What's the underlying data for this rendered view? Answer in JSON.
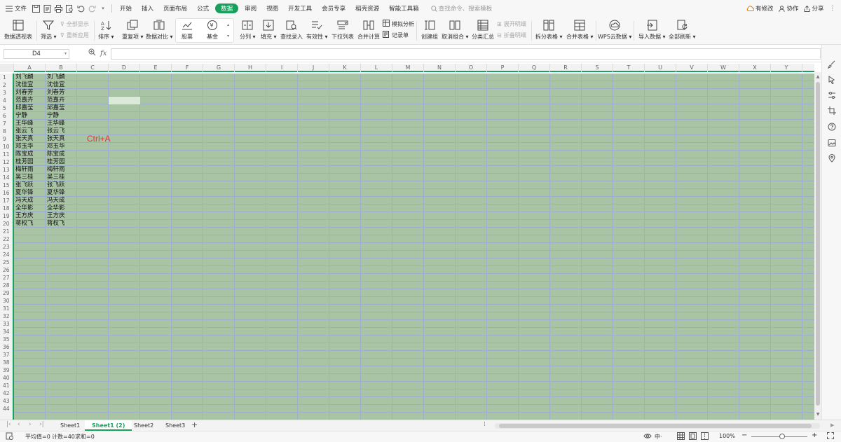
{
  "menubar": {
    "file_label": "文件",
    "tabs": [
      "开始",
      "插入",
      "页面布局",
      "公式",
      "数据",
      "审阅",
      "视图",
      "开发工具",
      "会员专享",
      "稻壳资源",
      "智能工具箱"
    ],
    "active_tab": "数据",
    "search_placeholder": "查找命令、搜索模板",
    "right": {
      "changes": "有修改",
      "collab": "协作",
      "share": "分享"
    }
  },
  "ribbon": {
    "pivot": "数据透视表",
    "filter": "筛选",
    "show_all": "全部显示",
    "reapply": "重新应用",
    "sort": "排序",
    "duplicates": "重复项",
    "compare": "数据对比",
    "stock": "股票",
    "fund": "基金",
    "split_col": "分列",
    "fill": "填充",
    "lookup_entry": "查找录入",
    "validity": "有效性",
    "dropdown_list": "下拉列表",
    "consolidate": "合并计算",
    "simulate": "模拟分析",
    "record_form": "记录单",
    "create_group": "创建组",
    "ungroup": "取消组合",
    "subtotal": "分类汇总",
    "expand_detail": "展开明细",
    "collapse_detail": "折叠明细",
    "split_table": "拆分表格",
    "merge_table": "合并表格",
    "wps_cloud": "WPS云数据",
    "import_data": "导入数据",
    "refresh_all": "全部刷新"
  },
  "formula": {
    "name_box": "D4",
    "value": ""
  },
  "columns": [
    "A",
    "B",
    "C",
    "D",
    "E",
    "F",
    "G",
    "H",
    "I",
    "J",
    "K",
    "L",
    "M",
    "N",
    "O",
    "P",
    "Q",
    "R",
    "S",
    "T",
    "U",
    "V",
    "W",
    "X",
    "Y"
  ],
  "rows": [
    "1",
    "2",
    "3",
    "4",
    "5",
    "6",
    "7",
    "8",
    "9",
    "10",
    "11",
    "12",
    "13",
    "14",
    "15",
    "16",
    "17",
    "18",
    "19",
    "20",
    "21",
    "22",
    "23",
    "24",
    "25",
    "26",
    "27",
    "28",
    "29",
    "30",
    "31",
    "32",
    "33",
    "34",
    "35",
    "36",
    "37",
    "38",
    "39",
    "40",
    "41",
    "42",
    "43",
    "44"
  ],
  "names": [
    "刘飞麟",
    "沈佳宜",
    "刘春芳",
    "范嘉卉",
    "邱嘉莹",
    "宁静",
    "王华峰",
    "张云飞",
    "张天真",
    "邓玉华",
    "陈宝成",
    "桂芳园",
    "梅轩雨",
    "吴三桂",
    "张飞跃",
    "夏华锋",
    "冯天成",
    "全华影",
    "王方庆",
    "蒋权飞"
  ],
  "annotation": "Ctrl+A",
  "sheets": [
    "Sheet1",
    "Sheet1 (2)",
    "Sheet2",
    "Sheet3"
  ],
  "active_sheet": "Sheet1 (2)",
  "status": {
    "average": "平均值=0",
    "count": "计数=40",
    "sum": "求和=0",
    "zoom": "100%"
  },
  "colors": {
    "accent": "#1aa05d",
    "selection": "#a9c3a5",
    "active_cell": "#d9ebd6",
    "annotation": "#e53935"
  }
}
